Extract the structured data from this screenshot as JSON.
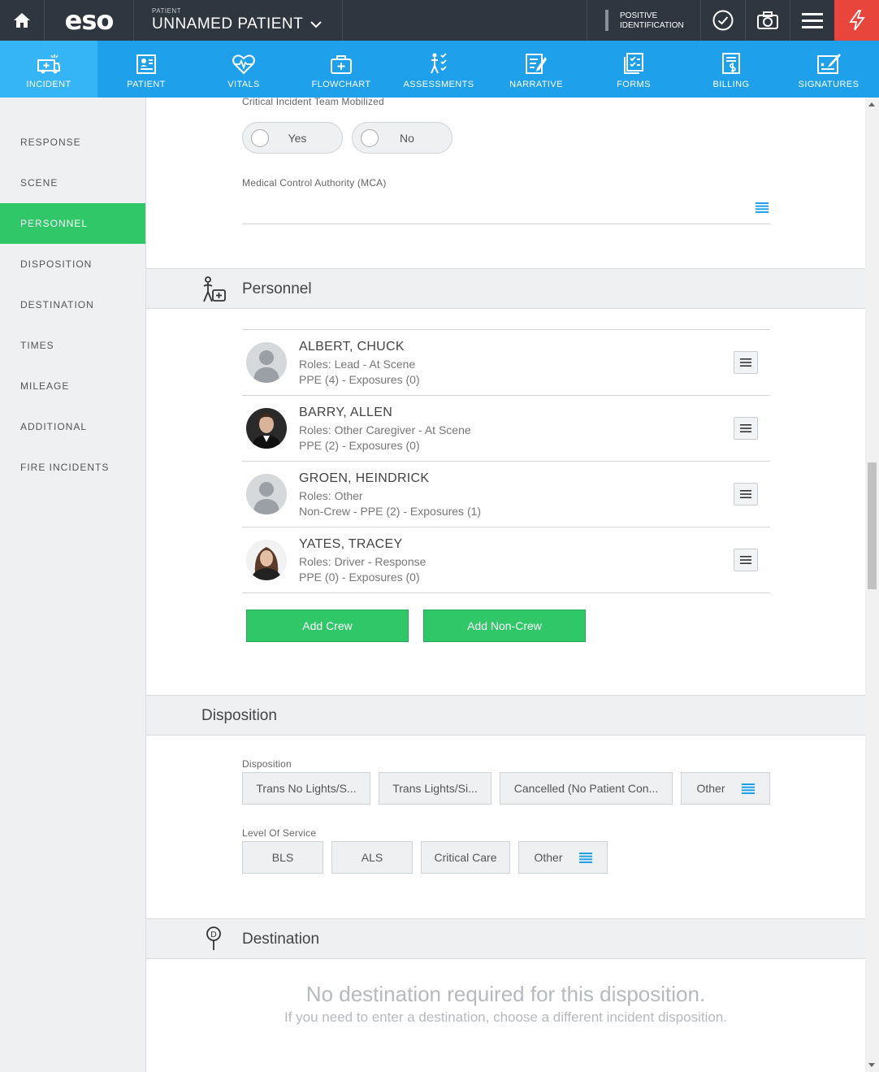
{
  "topbar": {
    "logo": "eso",
    "patient_label": "PATIENT",
    "patient_name": "UNNAMED PATIENT",
    "positive_id_line1": "POSITIVE",
    "positive_id_line2": "IDENTIFICATION"
  },
  "nav": {
    "items": [
      {
        "label": "INCIDENT",
        "icon": "ambulance-icon",
        "active": true
      },
      {
        "label": "PATIENT",
        "icon": "patient-chart-icon"
      },
      {
        "label": "VITALS",
        "icon": "heartbeat-icon"
      },
      {
        "label": "FLOWCHART",
        "icon": "medkit-icon"
      },
      {
        "label": "ASSESSMENTS",
        "icon": "assessment-icon"
      },
      {
        "label": "NARRATIVE",
        "icon": "narrative-icon"
      },
      {
        "label": "FORMS",
        "icon": "forms-icon"
      },
      {
        "label": "BILLING",
        "icon": "billing-icon"
      },
      {
        "label": "SIGNATURES",
        "icon": "signature-icon"
      }
    ]
  },
  "sidebar": {
    "items": [
      {
        "label": "RESPONSE"
      },
      {
        "label": "SCENE"
      },
      {
        "label": "PERSONNEL",
        "active": true
      },
      {
        "label": "DISPOSITION"
      },
      {
        "label": "DESTINATION"
      },
      {
        "label": "TIMES"
      },
      {
        "label": "MILEAGE"
      },
      {
        "label": "ADDITIONAL"
      },
      {
        "label": "FIRE INCIDENTS"
      }
    ]
  },
  "critical_team": {
    "label": "Critical Incident Team Mobilized",
    "yes": "Yes",
    "no": "No"
  },
  "mca": {
    "label": "Medical Control Authority (MCA)"
  },
  "personnel": {
    "title": "Personnel",
    "rows": [
      {
        "name": "ALBERT, CHUCK",
        "roles": "Roles: Lead - At Scene",
        "ppe": "PPE (4) - Exposures (0)"
      },
      {
        "name": "BARRY, ALLEN",
        "roles": "Roles: Other Caregiver - At Scene",
        "ppe": "PPE (2) - Exposures (0)"
      },
      {
        "name": "GROEN, HEINDRICK",
        "roles": "Roles: Other",
        "ppe": "Non-Crew - PPE (2) - Exposures (1)"
      },
      {
        "name": "YATES, TRACEY",
        "roles": "Roles: Driver - Response",
        "ppe": "PPE (0) - Exposures (0)"
      }
    ],
    "add_crew": "Add Crew",
    "add_non_crew": "Add Non-Crew"
  },
  "disposition": {
    "title": "Disposition",
    "disposition_label": "Disposition",
    "disposition_options": [
      "Trans No Lights/S...",
      "Trans Lights/Si...",
      "Cancelled (No Patient Con...",
      "Other"
    ],
    "los_label": "Level Of Service",
    "los_options": [
      "BLS",
      "ALS",
      "Critical Care",
      "Other"
    ]
  },
  "destination": {
    "title": "Destination",
    "message": "No destination required for this disposition.",
    "sub_message": "If you need to enter a destination, choose a different incident disposition."
  },
  "colors": {
    "topbar": "#2f3640",
    "nav": "#1fa0ea",
    "nav_active": "#35b5f5",
    "accent_green": "#2fc767",
    "alert_red": "#e8463c"
  }
}
